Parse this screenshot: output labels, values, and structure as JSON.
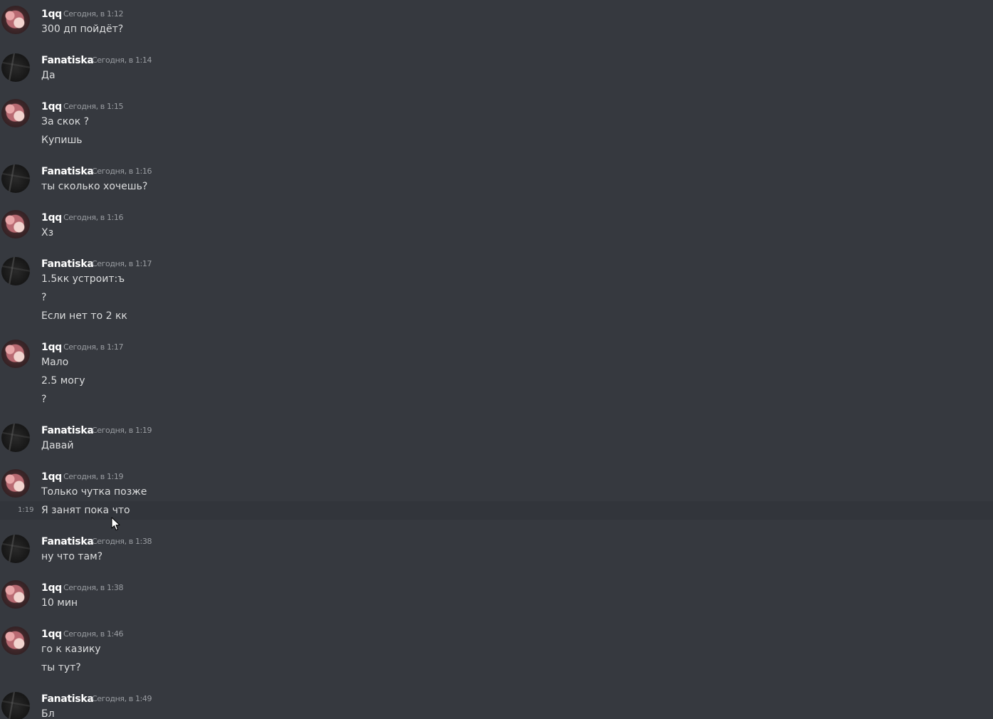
{
  "messages": [
    {
      "author": "1qq",
      "time": "Сегодня, в 1:12",
      "lines": [
        "300 дп пойдёт?"
      ]
    },
    {
      "author": "Fanatiska",
      "time": "Сегодня, в 1:14",
      "lines": [
        "Да"
      ]
    },
    {
      "author": "1qq",
      "time": "Сегодня, в 1:15",
      "lines": [
        "За скок ?",
        "Купишь"
      ]
    },
    {
      "author": "Fanatiska",
      "time": "Сегодня, в 1:16",
      "lines": [
        "ты сколько хочешь?"
      ]
    },
    {
      "author": "1qq",
      "time": "Сегодня, в 1:16",
      "lines": [
        "Хз"
      ]
    },
    {
      "author": "Fanatiska",
      "time": "Сегодня, в 1:17",
      "lines": [
        "1.5кк устроит:ъ",
        "?",
        "Если нет то 2 кк"
      ]
    },
    {
      "author": "1qq",
      "time": "Сегодня, в 1:17",
      "lines": [
        "Мало",
        "2.5 могу",
        "?"
      ]
    },
    {
      "author": "Fanatiska",
      "time": "Сегодня, в 1:19",
      "lines": [
        "Давай"
      ]
    },
    {
      "author": "1qq",
      "time": "Сегодня, в 1:19",
      "lines": [
        "Только чутка позже",
        "Я занят пока что"
      ]
    },
    {
      "author": "Fanatiska",
      "time": "Сегодня, в 1:38",
      "lines": [
        "ну что там?"
      ]
    },
    {
      "author": "1qq",
      "time": "Сегодня, в 1:38",
      "lines": [
        "10 мин"
      ]
    },
    {
      "author": "1qq",
      "time": "Сегодня, в 1:46",
      "lines": [
        "го к казику",
        "ты тут?"
      ]
    },
    {
      "author": "Fanatiska",
      "time": "Сегодня, в 1:49",
      "lines": [
        "Бл"
      ]
    }
  ],
  "hovered_line": {
    "side_time": "1:19"
  },
  "colors": {
    "background": "#36393f",
    "hover_row": "#32353b",
    "username": "#ffffff",
    "timestamp": "#9a9da2",
    "message_text": "#dcddde"
  },
  "icons": {
    "cursor": "arrow-cursor-icon"
  }
}
